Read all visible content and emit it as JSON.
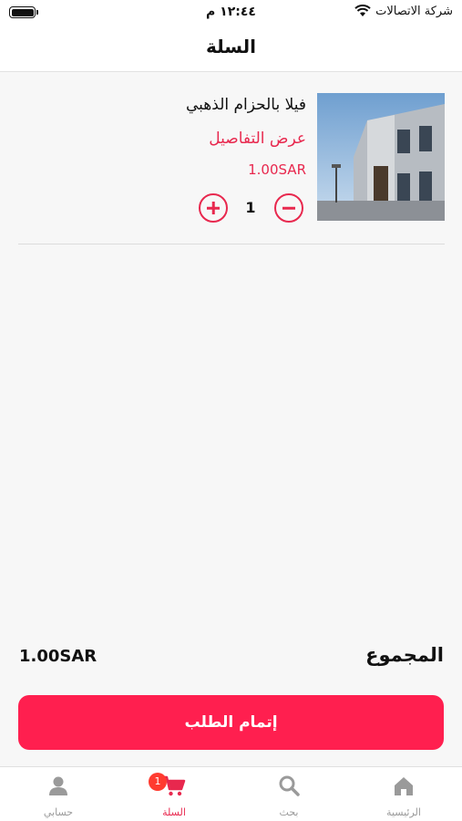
{
  "status_bar": {
    "carrier": "شركة الاتصالات",
    "time": "١٢:٤٤ م"
  },
  "header": {
    "title": "السلة"
  },
  "cart": {
    "items": [
      {
        "name": "فيلا بالحزام الذهبي",
        "details_link": "عرض التفاصيل",
        "price": "1.00SAR",
        "quantity": "1",
        "image_icon": "villa-photo"
      }
    ]
  },
  "summary": {
    "total_label": "المجموع",
    "total_value": "1.00SAR"
  },
  "checkout": {
    "label": "إتمام الطلب"
  },
  "tabbar": {
    "home": {
      "label": "الرئيسية",
      "icon": "home-icon"
    },
    "search": {
      "label": "بحث",
      "icon": "search-icon"
    },
    "cart": {
      "label": "السلة",
      "icon": "cart-icon",
      "badge": "1"
    },
    "account": {
      "label": "حسابي",
      "icon": "person-icon"
    }
  },
  "colors": {
    "accent": "#e8284e",
    "button": "#ff1f4f",
    "badge": "#ff3b30",
    "inactive": "#9a9a9a"
  }
}
